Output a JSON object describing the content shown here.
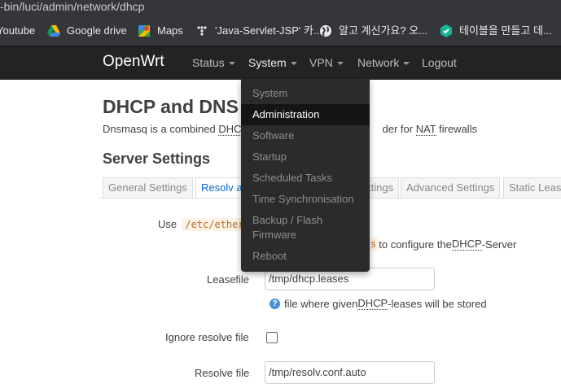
{
  "browser": {
    "url": "-bin/luci/admin/network/dhcp",
    "bookmarks": [
      {
        "label": "Youtube",
        "icon": "youtube-icon"
      },
      {
        "label": "Google drive",
        "icon": "google-drive-icon"
      },
      {
        "label": "Maps",
        "icon": "maps-icon"
      },
      {
        "label": "'Java-Servlet-JSP' 카...",
        "icon": "tistory-icon"
      },
      {
        "label": "알고 계신가요? 오...",
        "icon": "globe-icon"
      },
      {
        "label": "테이블을 만들고 데...",
        "icon": "bookmark-site-icon"
      }
    ]
  },
  "header": {
    "brand": "OpenWrt",
    "nav": [
      "Status",
      "System",
      "VPN",
      "Network",
      "Logout"
    ]
  },
  "dropdown": {
    "items": [
      "System",
      "Administration",
      "Software",
      "Startup",
      "Scheduled Tasks",
      "Time Synchronisation",
      "Backup / Flash Firmware",
      "Reboot"
    ],
    "active": "Administration"
  },
  "page": {
    "title": "DHCP and DNS",
    "desc_start": "Dnsmasq is a combined ",
    "desc_abbr1": "DHC",
    "desc_mid": "der for ",
    "desc_abbr2": "NAT",
    "desc_end": " firewalls",
    "section_title": "Server Settings",
    "tabs": [
      "General Settings",
      "Resolv a",
      "ttings",
      "Advanced Settings",
      "Static Leas"
    ],
    "active_tab": "Resolv a"
  },
  "form": {
    "use_label": "Use",
    "use_code": "/etc/ether",
    "use_hint_code": "s",
    "use_hint_pre": " to configure the ",
    "use_hint_abbr": "DHCP",
    "use_hint_post": "-Server",
    "leasefile_label": "Leasefile",
    "leasefile_value": "/tmp/dhcp.leases",
    "leasefile_hint_pre": "file where given ",
    "leasefile_hint_abbr": "DHCP",
    "leasefile_hint_post": "-leases will be stored",
    "ignore_resolve_label": "Ignore resolve file",
    "resolve_file_label": "Resolve file",
    "resolve_file_value": "/tmp/resolv.conf.auto"
  }
}
